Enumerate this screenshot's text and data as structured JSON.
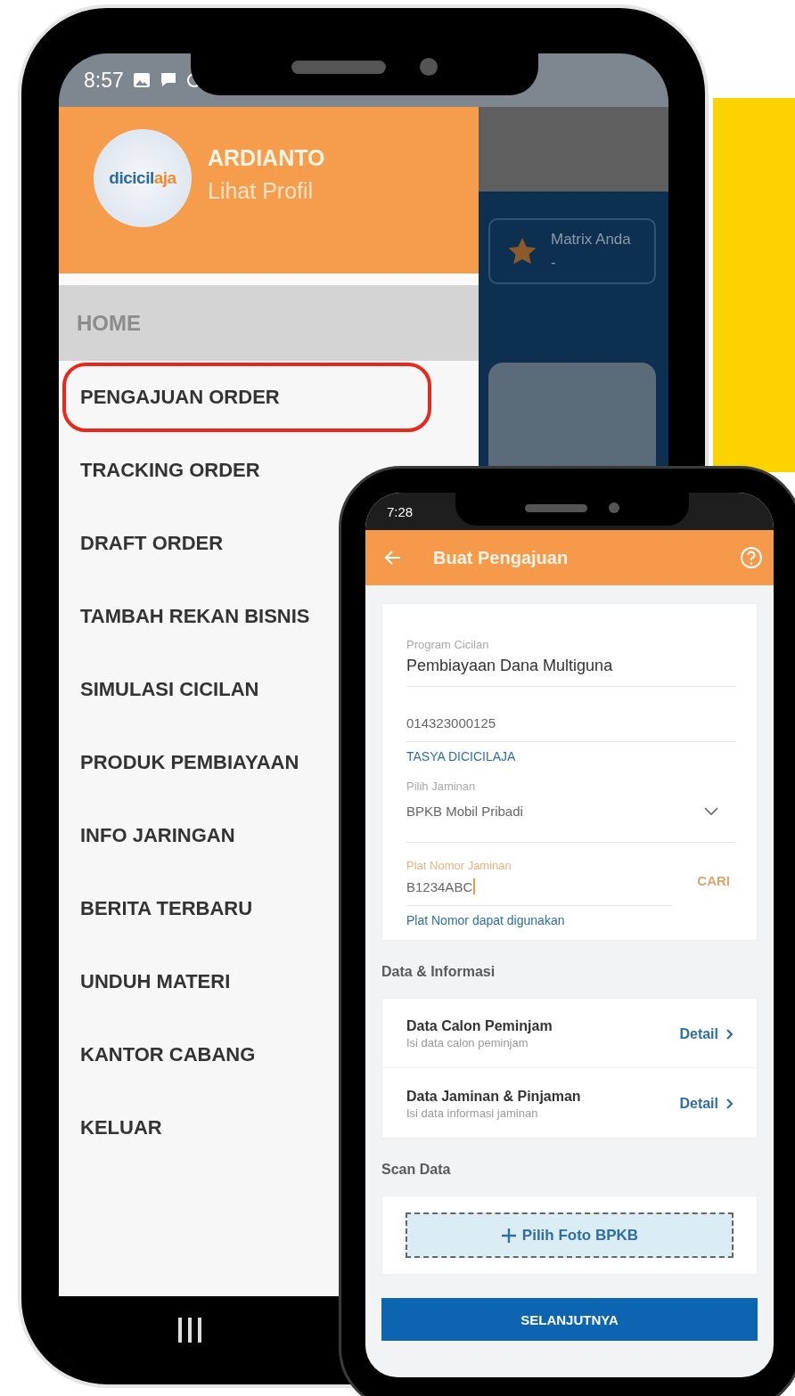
{
  "main_phone": {
    "status_bar": {
      "time": "8:57"
    },
    "drawer": {
      "logo": {
        "primary": "dicicil",
        "accent": "aja"
      },
      "user_name": "ARDIANTO",
      "profile_link": "Lihat Profil",
      "section_header": "HOME",
      "items": [
        {
          "label": "PENGAJUAN ORDER",
          "highlighted": true
        },
        {
          "label": "TRACKING ORDER",
          "highlighted": false
        },
        {
          "label": "DRAFT ORDER",
          "highlighted": false
        },
        {
          "label": "TAMBAH REKAN BISNIS",
          "highlighted": false
        },
        {
          "label": "SIMULASI CICILAN",
          "highlighted": false
        },
        {
          "label": "PRODUK PEMBIAYAAN",
          "highlighted": false
        },
        {
          "label": "INFO JARINGAN",
          "highlighted": false
        },
        {
          "label": "BERITA TERBARU",
          "highlighted": false
        },
        {
          "label": "UNDUH MATERI",
          "highlighted": false
        },
        {
          "label": "KANTOR CABANG",
          "highlighted": false
        },
        {
          "label": "KELUAR",
          "highlighted": false
        }
      ]
    },
    "background_screen": {
      "card_label": "Matrix Anda",
      "card_value": "-"
    }
  },
  "form_phone": {
    "status_bar": {
      "time": "7:28"
    },
    "app_bar": {
      "title": "Buat Pengajuan"
    },
    "fields": [
      {
        "kind": "text",
        "label": "Program Cicilan",
        "value": "Pembiayaan Dana Multiguna"
      },
      {
        "kind": "text",
        "value": "014323000125",
        "note": "TASYA DICICILAJA"
      },
      {
        "kind": "select",
        "label": "Pilih Jaminan",
        "value": "BPKB Mobil Pribadi"
      },
      {
        "kind": "search",
        "label": "Plat Nomor Jaminan",
        "value": "B1234ABC",
        "focused": true,
        "action": "CARI",
        "note": "Plat Nomor dapat digunakan"
      }
    ],
    "info_section": {
      "title": "Data & Informasi",
      "rows": [
        {
          "title": "Data Calon Peminjam",
          "subtitle": "Isi data calon peminjam",
          "action": "Detail"
        },
        {
          "title": "Data Jaminan & Pinjaman",
          "subtitle": "Isi data informasi jaminan",
          "action": "Detail"
        }
      ]
    },
    "scan_section": {
      "title": "Scan Data",
      "upload_label": "Pilih Foto BPKB"
    },
    "submit_button": "SELANJUTNYA"
  }
}
